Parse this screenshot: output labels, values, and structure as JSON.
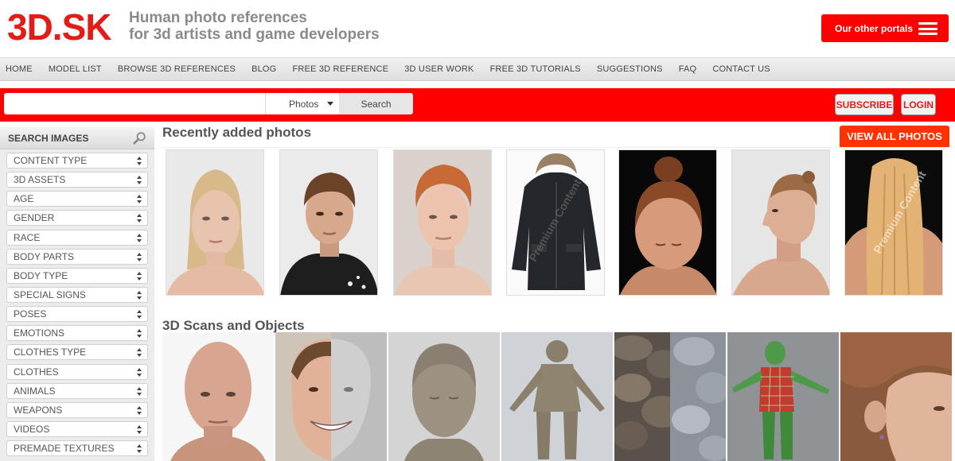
{
  "header": {
    "logo": "3D.SK",
    "tagline_line1": "Human photo references",
    "tagline_line2": "for 3d artists and game developers",
    "portals_label": "Our other portals"
  },
  "nav": {
    "items": [
      "HOME",
      "MODEL LIST",
      "BROWSE 3D REFERENCES",
      "BLOG",
      "FREE 3D REFERENCE",
      "3D USER WORK",
      "FREE 3D TUTORIALS",
      "SUGGESTIONS",
      "FAQ",
      "CONTACT US"
    ]
  },
  "search": {
    "placeholder": "",
    "select_value": "Photos",
    "button_label": "Search",
    "subscribe_label": "SUBSCRIBE",
    "login_label": "LOGIN"
  },
  "sidebar": {
    "title": "SEARCH IMAGES",
    "filters": [
      "CONTENT TYPE",
      "3D ASSETS",
      "AGE",
      "GENDER",
      "RACE",
      "BODY PARTS",
      "BODY TYPE",
      "SPECIAL SIGNS",
      "POSES",
      "EMOTIONS",
      "CLOTHES TYPE",
      "CLOTHES",
      "ANIMALS",
      "WEAPONS",
      "VIDEOS",
      "PREMADE TEXTURES"
    ]
  },
  "main": {
    "recent_title": "Recently added photos",
    "view_all_label": "VIEW ALL PHOTOS",
    "scans_title": "3D Scans and Objects",
    "watermark": "Premium Content"
  },
  "colors": {
    "brand_red": "#ff0000",
    "logo_red": "#e41b17",
    "view_all_orange": "#ff3300"
  }
}
